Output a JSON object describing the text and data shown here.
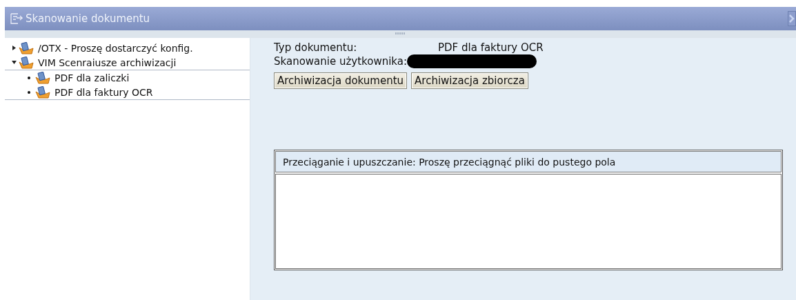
{
  "window": {
    "title": "Skanowanie dokumentu"
  },
  "tree": [
    {
      "label": "/OTX - Proszę dostarczyć konfig.",
      "expanded": false
    },
    {
      "label": "VIM Scenraiusze archiwizacji",
      "expanded": true,
      "children": [
        {
          "label": "PDF dla zaliczki"
        },
        {
          "label": "PDF dla faktury OCR"
        }
      ]
    }
  ],
  "fields": [
    {
      "label": "Typ dokumentu:",
      "value": "PDF dla faktury OCR",
      "kind": "text"
    },
    {
      "label": "Skanowanie użytkownika:",
      "kind": "redacted"
    }
  ],
  "buttons": [
    "Archiwizacja dokumentu",
    "Archiwizacja zbiorcza"
  ],
  "drop_area": {
    "title": "Przeciąganie i upuszczanie: Proszę przeciągnąć pliki do pustego pola"
  }
}
